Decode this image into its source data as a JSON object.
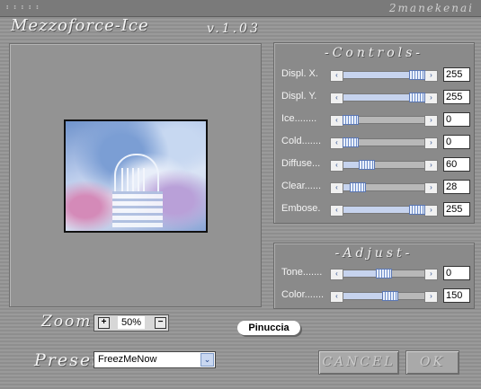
{
  "window": {
    "title": "Mezzoforce-Ice",
    "version": "v.1.03",
    "author": "2manekenai",
    "dots": "⠆⠆⠆⠆⠆"
  },
  "preview": {
    "image_desc_icon": "winter-garden-preview"
  },
  "zoom": {
    "label": "Zoom",
    "value": "50%",
    "plus": "+",
    "minus": "−"
  },
  "logo": {
    "text": "Pinuccia"
  },
  "preset": {
    "label": "Preset",
    "value": "FreezMeNow",
    "arrow": "⌄"
  },
  "buttons": {
    "cancel": "CANCEL",
    "ok": "OK"
  },
  "controls": {
    "title": "-Controls-",
    "sliders": [
      {
        "label": "Displ. X.",
        "value": "255",
        "level": 1.0
      },
      {
        "label": "Displ. Y.",
        "value": "255",
        "level": 1.0
      },
      {
        "label": "Ice........",
        "value": "0",
        "level": 0.0
      },
      {
        "label": "Cold.......",
        "value": "0",
        "level": 0.0
      },
      {
        "label": "Diffuse...",
        "value": "60",
        "level": 0.24
      },
      {
        "label": "Clear......",
        "value": "28",
        "level": 0.11
      },
      {
        "label": "Embose.",
        "value": "255",
        "level": 1.0
      }
    ]
  },
  "adjust": {
    "title": "-Adjust-",
    "sliders": [
      {
        "label": "Tone.......",
        "value": "0",
        "level": 0.5
      },
      {
        "label": "Color.......",
        "value": "150",
        "level": 0.59
      }
    ]
  },
  "colors": {
    "panel": "#8a8a8a",
    "accent": "#6f8fcb"
  }
}
